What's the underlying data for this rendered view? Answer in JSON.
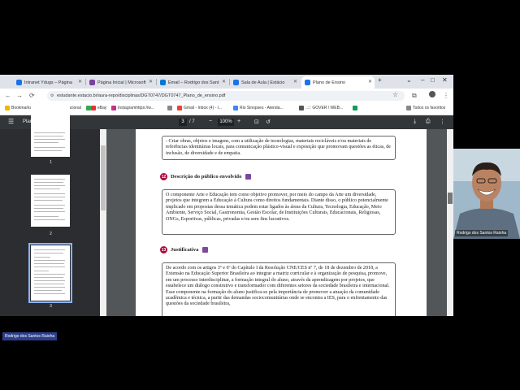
{
  "tabs": [
    {
      "label": "Intranet Ydugs – Página",
      "color": "#1a73e8"
    },
    {
      "label": "Página Inicial | Microsoft",
      "color": "#7b3fa0"
    },
    {
      "label": "Email – Rodrigo dos Sant",
      "color": "#0078d4"
    },
    {
      "label": "Sala de Aula | Estácio",
      "color": "#1a73e8"
    },
    {
      "label": "Plano de Ensino",
      "color": "#1a73e8"
    }
  ],
  "url": "estudante.estacio.br/aura-repo/disciplinas/DGT0747/DGT0747_Plano_de_ensino.pdf",
  "bookmarks": [
    {
      "label": "Bookmarks"
    },
    {
      "label": "Desen. educacional"
    },
    {
      "label": ""
    },
    {
      "label": "eBay"
    },
    {
      "label": "Instagramhttps://w..."
    },
    {
      "label": ""
    },
    {
      "label": "Gmail - Inbox (4) - l..."
    },
    {
      "label": "Rio Sinopses - Atenda..."
    },
    {
      "label": "..::: GOVER / WEB..."
    },
    {
      "label": ""
    },
    {
      "label": "Todos os favoritos"
    }
  ],
  "pdf": {
    "title": "Plano de Ensino",
    "page_current": "3",
    "page_total": "/ 7",
    "zoom": "100%"
  },
  "thumbnails": [
    {
      "num": "1"
    },
    {
      "num": "2"
    },
    {
      "num": "3"
    }
  ],
  "document": {
    "intro_text": "- Criar obras, objetos e imagens, com a utilização de tecnologias, materiais recicláveis e/ou materiais de referências identitárias locais, para comunicação plástico-visual e exposição que promovam questões as éticas, de inclusão, de diversidade e de empatia.",
    "sec12_num": "12",
    "sec12_title": "Descrição do público envolvido",
    "sec12_text": "O componente Arte e Educação tem como objetivo promover, por meio do campo da Arte um diversidade, projetos que integrem a Educação à Cultura como direitos fundamentais. Diante disso, o público potencialmente implicado em propostas dessa temática podem estar ligados às áreas da Cultura, Tecnologia, Educação, Meio Ambiente, Serviço Social, Gastronomia, Gestão Escolar, de Instituições Culturais, Educacionais, Religiosas, ONGs, Esportivas, públicas, privadas e/ou sem fins lucrativos.",
    "sec13_num": "13",
    "sec13_title": "Justificativa",
    "sec13_text": "De acordo com os artigos 3º e 6º do Capítulo I da Resolução CNE/CES nº 7, de 18 de dezembro de 2018, a Extensão na Educação Superior Brasileira ao integrar a matriz curricular e à organização de pesquisa, promove, em um processo interdisciplinar, a formação integral do aluno, através da aprendizagem por projetos, que estabelece um diálogo construtivo e transformador com diferentes setores da sociedade brasileira e internacional. Esse componente na formação do aluno justifica-se pela importância de promover a atuação da comunidade acadêmica e técnica, a partir das demandas socio­comunitárias onde se encontra a IES, para o enfrentamento das questões da sociedade brasileira,"
  },
  "participant": {
    "name": "Rodrigo dos Santos Raioha"
  }
}
